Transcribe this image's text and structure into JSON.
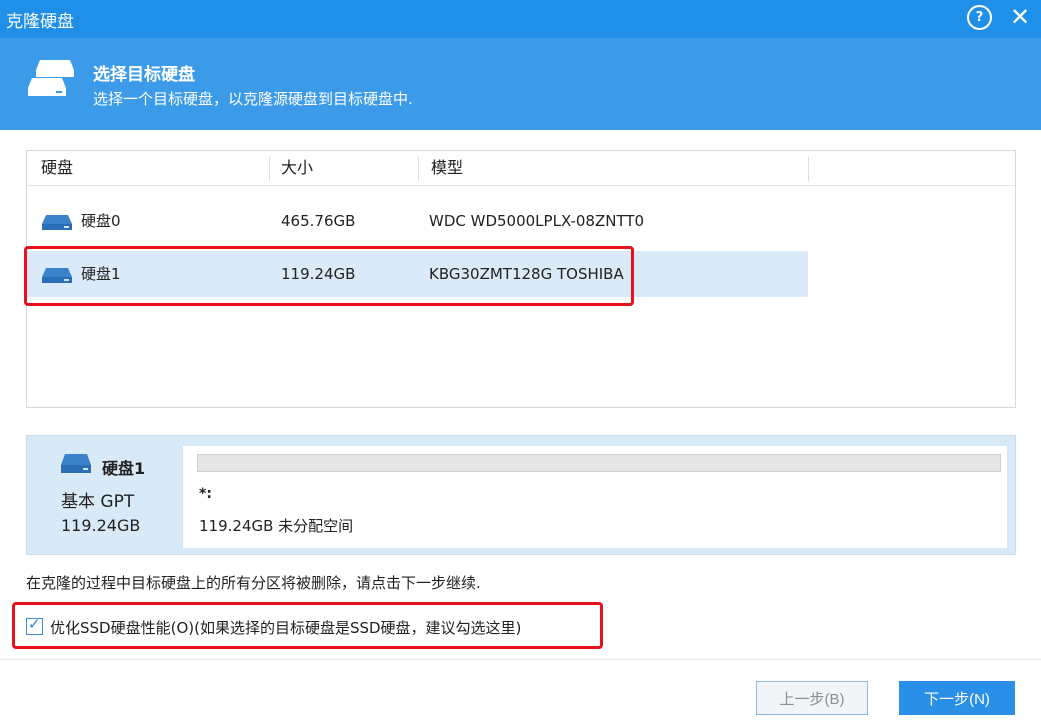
{
  "window": {
    "title": "克隆硬盘",
    "help_icon": "?"
  },
  "banner": {
    "title": "选择目标硬盘",
    "subtitle": "选择一个目标硬盘，以克隆源硬盘到目标硬盘中."
  },
  "disk_table": {
    "columns": [
      "硬盘",
      "大小",
      "模型"
    ],
    "rows": [
      {
        "name": "硬盘0",
        "size": "465.76GB",
        "model": "WDC WD5000LPLX-08ZNTT0",
        "selected": false
      },
      {
        "name": "硬盘1",
        "size": "119.24GB",
        "model": "KBG30ZMT128G TOSHIBA",
        "selected": true
      }
    ]
  },
  "selected_disk": {
    "name": "硬盘1",
    "type": "基本 GPT",
    "size": "119.24GB",
    "partition_label": "*:",
    "unallocated": "119.24GB 未分配空间"
  },
  "warning_text": "在克隆的过程中目标硬盘上的所有分区将被删除，请点击下一步继续.",
  "optimize_ssd": {
    "checked": true,
    "label": "优化SSD硬盘性能(O)(如果选择的目标硬盘是SSD硬盘，建议勾选这里)"
  },
  "buttons": {
    "prev": "上一步(B)",
    "next": "下一步(N)"
  },
  "colors": {
    "titlebar": "#1f8fe7",
    "banner": "#3c9be9",
    "selected_row": "#dbeaf8",
    "highlight": "#e8121d"
  }
}
